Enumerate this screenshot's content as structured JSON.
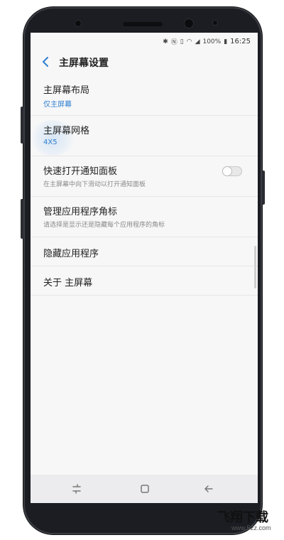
{
  "status_bar": {
    "battery": "100%",
    "time": "16:25",
    "icons": [
      "bluetooth-icon",
      "nfc-icon",
      "vibrate-icon",
      "wifi-icon",
      "signal-icon",
      "battery-icon"
    ]
  },
  "header": {
    "title": "主屏幕设置",
    "back_icon": "chevron-left-icon"
  },
  "settings": {
    "items": [
      {
        "title": "主屏幕布局",
        "subtitle": "仅主屏幕"
      },
      {
        "title": "主屏幕网格",
        "subtitle": "4X5"
      },
      {
        "title": "快速打开通知面板",
        "subtitle": "在主屏幕中向下滑动以打开通知面板",
        "toggle": "off"
      },
      {
        "title": "管理应用程序角标",
        "subtitle": "请选择是显示还是隐藏每个应用程序的角标"
      },
      {
        "title": "隐藏应用程序"
      },
      {
        "title": "关于 主屏幕"
      }
    ]
  },
  "nav_bar": {
    "items": [
      "recents-icon",
      "home-icon",
      "back-icon"
    ]
  },
  "watermark": {
    "logo": "飞翔下载",
    "url": "www.52z.com"
  },
  "colors": {
    "accent": "#2d7fcf",
    "screen_bg": "#f7f7f8",
    "phone_body": "#1b1d22"
  }
}
